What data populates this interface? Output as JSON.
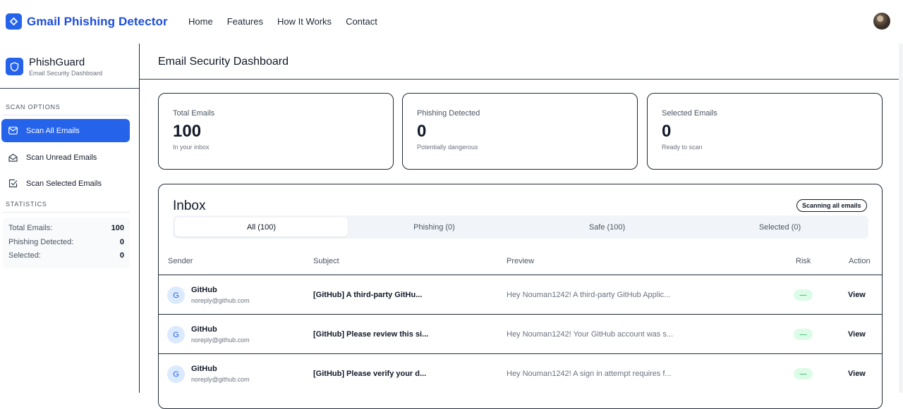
{
  "brand": {
    "title": "Gmail Phishing Detector",
    "logo_icon": "diamond-icon"
  },
  "nav": [
    "Home",
    "Features",
    "How It Works",
    "Contact"
  ],
  "sidebar": {
    "title": "PhishGuard",
    "subtitle": "Email Security Dashboard",
    "scan_section": "SCAN OPTIONS",
    "items": [
      {
        "label": "Scan All Emails",
        "icon": "mail-icon",
        "active": true
      },
      {
        "label": "Scan Unread Emails",
        "icon": "mail-open-icon",
        "active": false
      },
      {
        "label": "Scan Selected Emails",
        "icon": "check-square-icon",
        "active": false
      }
    ],
    "stats_section": "STATISTICS",
    "stats": [
      {
        "label": "Total Emails:",
        "value": "100"
      },
      {
        "label": "Phishing Detected:",
        "value": "0"
      },
      {
        "label": "Selected:",
        "value": "0"
      }
    ]
  },
  "main": {
    "title": "Email Security Dashboard",
    "cards": [
      {
        "label": "Total Emails",
        "value": "100",
        "note": "In your inbox"
      },
      {
        "label": "Phishing Detected",
        "value": "0",
        "note": "Potentially dangerous"
      },
      {
        "label": "Selected Emails",
        "value": "0",
        "note": "Ready to scan"
      }
    ]
  },
  "inbox": {
    "title": "Inbox",
    "badge": "Scanning all emails",
    "tabs": [
      "All (100)",
      "Phishing (0)",
      "Safe (100)",
      "Selected (0)"
    ],
    "columns": {
      "sender": "Sender",
      "subject": "Subject",
      "preview": "Preview",
      "risk": "Risk",
      "action": "Action"
    },
    "rows": [
      {
        "initial": "G",
        "sender": "GitHub",
        "email": "noreply@github.com",
        "subject": "[GitHub] A third-party GitHu...",
        "preview": "Hey Nouman1242! A third-party GitHub Applic...",
        "risk": "—",
        "action": "View"
      },
      {
        "initial": "G",
        "sender": "GitHub",
        "email": "noreply@github.com",
        "subject": "[GitHub] Please review this si...",
        "preview": "Hey Nouman1242! Your GitHub account was s...",
        "risk": "—",
        "action": "View"
      },
      {
        "initial": "G",
        "sender": "GitHub",
        "email": "noreply@github.com",
        "subject": "[GitHub] Please verify your d...",
        "preview": "Hey Nouman1242! A sign in attempt requires f...",
        "risk": "—",
        "action": "View"
      }
    ]
  },
  "colors": {
    "accent": "#2563eb",
    "safe": "#16a34a",
    "safe_bg": "#dcfce7"
  }
}
